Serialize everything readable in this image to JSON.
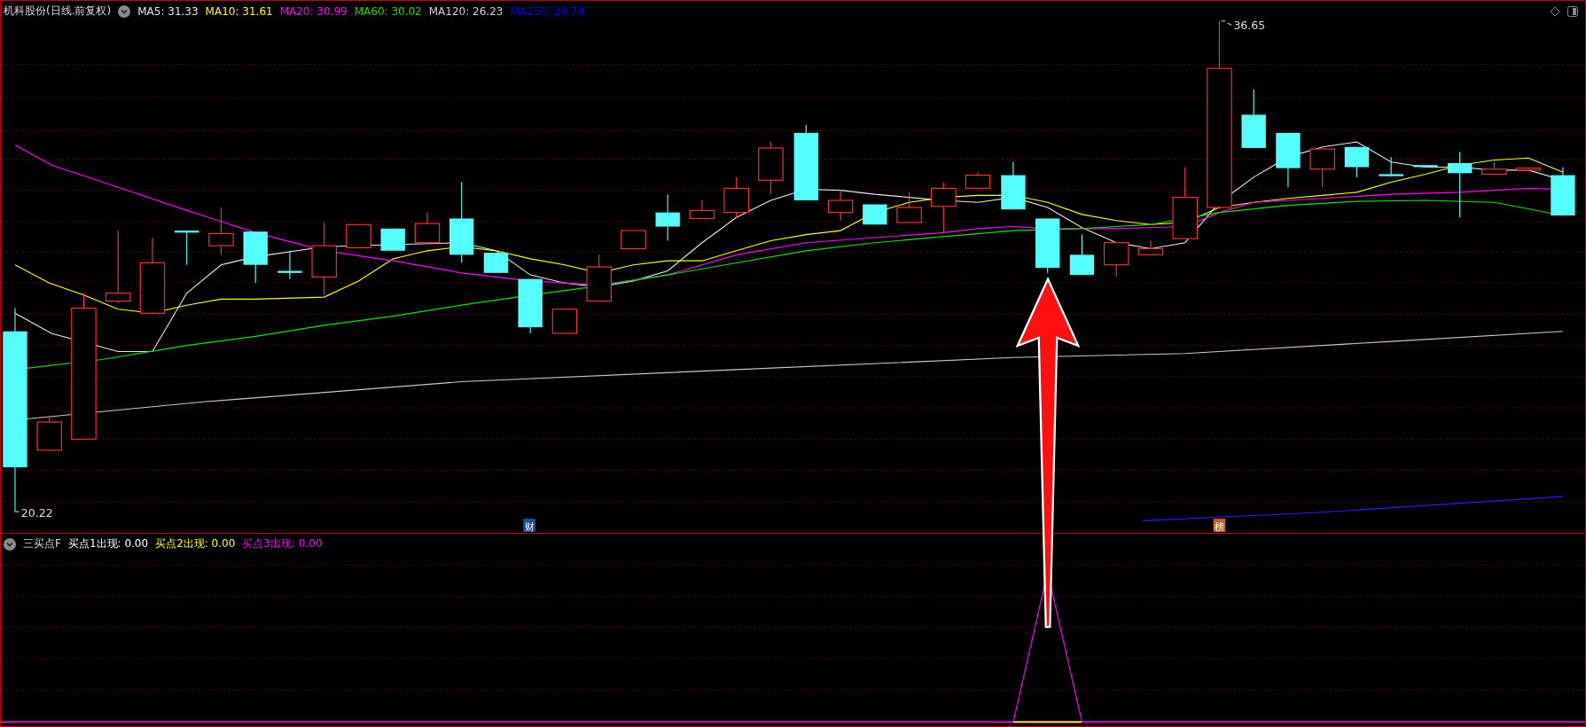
{
  "chart_header": {
    "title": "机科股份(日线.前复权)",
    "indicators": [
      {
        "label": "MA5: 31.33",
        "color": "#e8e8e8"
      },
      {
        "label": "MA10: 31.61",
        "color": "#ffff00"
      },
      {
        "label": "MA20: 30.99",
        "color": "#ff00ff"
      },
      {
        "label": "MA60: 30.02",
        "color": "#00e600"
      },
      {
        "label": "MA120: 26.23",
        "color": "#d0d0d0"
      },
      {
        "label": "MA250: 20.74",
        "color": "#0000ff"
      }
    ]
  },
  "price_labels": {
    "high": "36.65",
    "low": "20.22"
  },
  "event_markers": [
    {
      "label": "财",
      "color": "#1c4f96"
    },
    {
      "label": "榜",
      "color": "#c0651c"
    }
  ],
  "indicator_panel": {
    "title": "三买点F",
    "values": [
      {
        "label": "买点1出现: 0.00",
        "color": "#ffffff"
      },
      {
        "label": "买点2出现: 0.00",
        "color": "#ffff00"
      },
      {
        "label": "买点3出现: 0.00",
        "color": "#ff00ff"
      }
    ]
  }
}
